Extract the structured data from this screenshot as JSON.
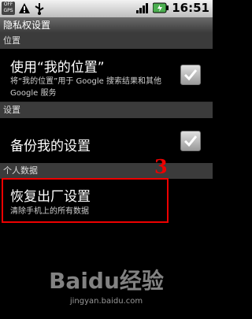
{
  "status_bar": {
    "off_badge": "OFF\nGPS",
    "time": "16:51",
    "icons": [
      "gps-off-icon",
      "warning-icon",
      "usb-icon",
      "signal-icon",
      "battery-icon"
    ]
  },
  "app": {
    "title": "隐私权设置"
  },
  "sections": [
    {
      "header": "位置",
      "items": [
        {
          "title": "使用“我的位置”",
          "summary": "将“我的位置”用于 Google 搜索结果和其他 Google 服务",
          "checkbox": "checked"
        }
      ]
    },
    {
      "header": "设置",
      "items": [
        {
          "title": "备份我的设置",
          "checkbox": "checked"
        }
      ]
    },
    {
      "header": "个人数据",
      "items": [
        {
          "title": "恢复出厂设置",
          "summary": "清除手机上的所有数据"
        }
      ]
    }
  ],
  "annotation": {
    "step": "3"
  },
  "watermark": {
    "brand": "Baidu经验",
    "url": "jingyan.baidu.com"
  },
  "colors": {
    "highlight": "#ee0000",
    "battery": "#4caf50"
  }
}
